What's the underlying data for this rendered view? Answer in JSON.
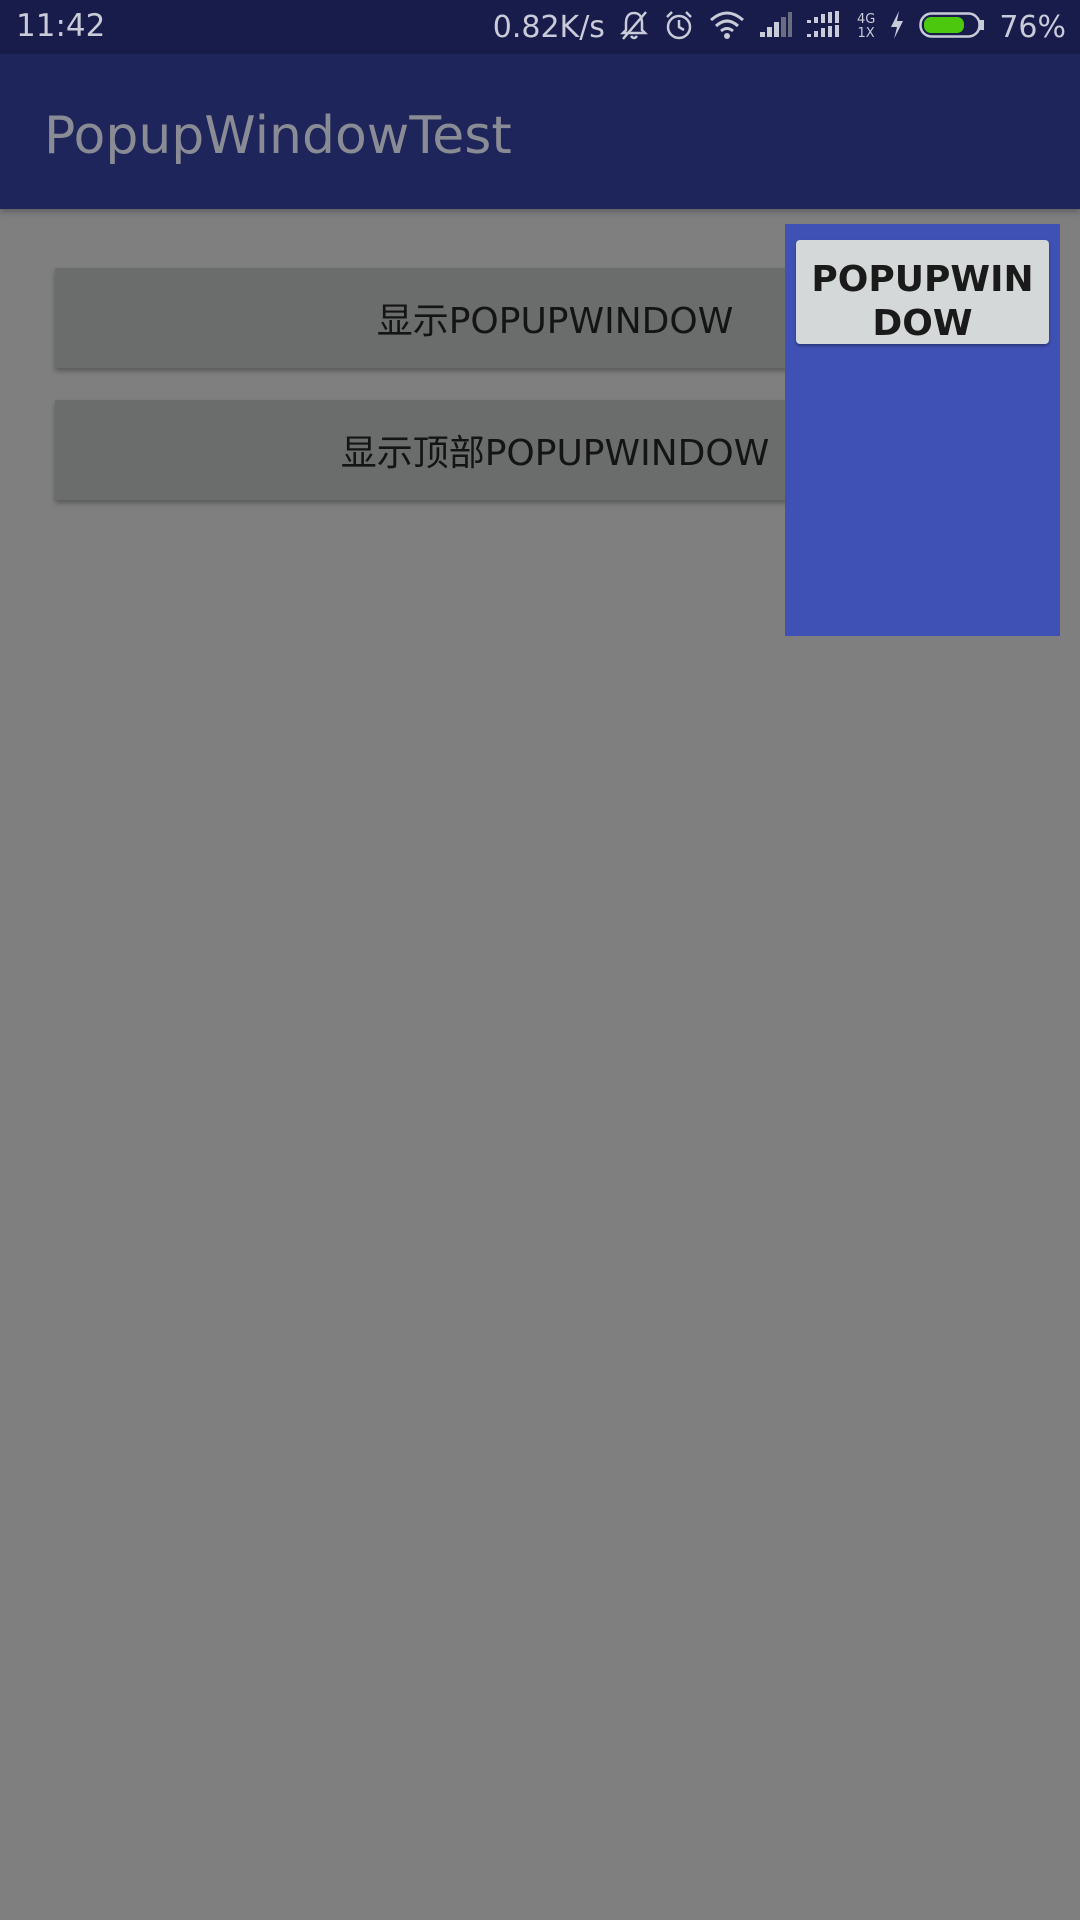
{
  "status_bar": {
    "time": "11:42",
    "net_speed": "0.82K/s",
    "network_top": "4G",
    "network_bottom": "1X",
    "battery_percent": "76%",
    "battery_level": 0.76,
    "battery_color": "#4cc80e",
    "icons": [
      "bell-off-icon",
      "alarm-icon",
      "wifi-icon",
      "signal-icon",
      "signal-dual-icon",
      "charging-icon",
      "battery-icon"
    ]
  },
  "app_bar": {
    "title": "PopupWindowTest",
    "color": "#1e255a"
  },
  "main": {
    "buttons": [
      {
        "label": "显示POPUPWINDOW"
      },
      {
        "label": "显示顶部POPUPWINDOW"
      }
    ]
  },
  "popup": {
    "background": "#3f51b5",
    "button_label": "POPUPWINDOW"
  }
}
